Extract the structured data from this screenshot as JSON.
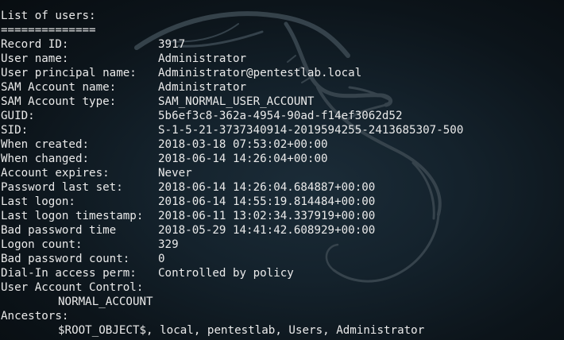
{
  "terminal": {
    "heading": "List of users:",
    "separator": "==============",
    "fields": [
      {
        "key": "Record ID:",
        "value": "3917"
      },
      {
        "key": "User name:",
        "value": "Administrator"
      },
      {
        "key": "User principal name:",
        "value": "Administrator@pentestlab.local"
      },
      {
        "key": "SAM Account name:",
        "value": "Administrator"
      },
      {
        "key": "SAM Account type:",
        "value": "SAM_NORMAL_USER_ACCOUNT"
      },
      {
        "key": "GUID:",
        "value": "5b6ef3c8-362a-4954-90ad-f14ef3062d52"
      },
      {
        "key": "SID:",
        "value": "S-1-5-21-3737340914-2019594255-2413685307-500"
      },
      {
        "key": "When created:",
        "value": "2018-03-18 07:53:02+00:00"
      },
      {
        "key": "When changed:",
        "value": "2018-06-14 14:26:04+00:00"
      },
      {
        "key": "Account expires:",
        "value": "Never"
      },
      {
        "key": "Password last set:",
        "value": "2018-06-14 14:26:04.684887+00:00"
      },
      {
        "key": "Last logon:",
        "value": "2018-06-14 14:55:19.814484+00:00"
      },
      {
        "key": "Last logon timestamp:",
        "value": "2018-06-11 13:02:34.337919+00:00"
      },
      {
        "key": "Bad password time",
        "value": "2018-05-29 14:41:42.608929+00:00"
      },
      {
        "key": "Logon count:",
        "value": "329"
      },
      {
        "key": "Bad password count:",
        "value": "0"
      },
      {
        "key": "Dial-In access perm:",
        "value": "Controlled by policy"
      }
    ],
    "uac_label": "User Account Control:",
    "uac_value": "NORMAL_ACCOUNT",
    "ancestors_label": "Ancestors:",
    "ancestors_value": "$ROOT_OBJECT$, local, pentestlab, Users, Administrator"
  },
  "wallpaper": {
    "icon": "kali-dragon-icon",
    "color": "#3c4a53"
  }
}
